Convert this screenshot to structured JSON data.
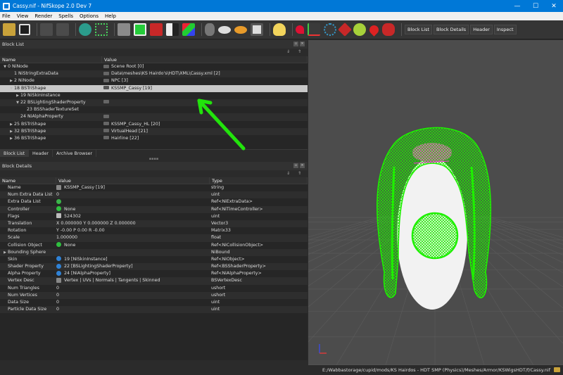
{
  "window": {
    "title": "Cassy.nif - NifSkope 2.0 Dev 7",
    "minimize": "—",
    "maximize": "☐",
    "close": "✕"
  },
  "menu": [
    "File",
    "View",
    "Render",
    "Spells",
    "Options",
    "Help"
  ],
  "toolbar": {
    "block_list": "Block List",
    "block_details": "Block Details",
    "header": "Header",
    "inspect": "Inspect"
  },
  "block_list": {
    "title": "Block List",
    "columns": [
      "Name",
      "Value"
    ],
    "rows": [
      {
        "name": "0 NiNode",
        "value": "Scene Root [0]",
        "indent": 0,
        "arrow": "▼"
      },
      {
        "name": "1 NiStringExtraData",
        "value": "Data\\meshes\\KS Hairdo's\\HDT\\XML\\Cassy.xml [2]",
        "indent": 1,
        "arrow": ""
      },
      {
        "name": "2 NiNode",
        "value": "NPC [3]",
        "indent": 1,
        "arrow": "▶"
      },
      {
        "name": "18 BSTriShape",
        "value": "KSSMP_Cassy [19]",
        "indent": 1,
        "arrow": "▼"
      },
      {
        "name": "19 NiSkinInstance",
        "value": "",
        "indent": 2,
        "arrow": "▶"
      },
      {
        "name": "22 BSLightingShaderProperty",
        "value": "",
        "indent": 2,
        "arrow": "▼"
      },
      {
        "name": "23 BSShaderTextureSet",
        "value": "",
        "indent": 3,
        "arrow": ""
      },
      {
        "name": "24 NiAlphaProperty",
        "value": "",
        "indent": 2,
        "arrow": ""
      },
      {
        "name": "25 BSTriShape",
        "value": "KSSMP_Cassy_HL [20]",
        "indent": 1,
        "arrow": "▶"
      },
      {
        "name": "32 BSTriShape",
        "value": "VirtualHead [21]",
        "indent": 1,
        "arrow": "▶"
      },
      {
        "name": "36 BSTriShape",
        "value": "Hairline [22]",
        "indent": 1,
        "arrow": "▶"
      }
    ],
    "selected_index": 3
  },
  "tabs": [
    "Block List",
    "Header",
    "Archive Browser"
  ],
  "block_details": {
    "title": "Block Details",
    "columns": [
      "Name",
      "Value",
      "Type"
    ],
    "rows": [
      {
        "name": "Name",
        "value": "KSSMP_Cassy [19]",
        "type": "string",
        "icon": "tag"
      },
      {
        "name": "Num Extra Data List",
        "value": "0",
        "type": "uint",
        "icon": ""
      },
      {
        "name": "Extra Data List",
        "value": "",
        "type": "Ref<NiExtraData>",
        "icon": "refresh"
      },
      {
        "name": "Controller",
        "value": "None",
        "type": "Ref<NiTimeController>",
        "icon": "plus"
      },
      {
        "name": "Flags",
        "value": "524302",
        "type": "uint",
        "icon": "flag"
      },
      {
        "name": "Translation",
        "value": "X 0.000000 Y 0.000000 Z 0.000000",
        "type": "Vector3",
        "icon": ""
      },
      {
        "name": "Rotation",
        "value": "Y -0.00 P 0.00 R -0.00",
        "type": "Matrix33",
        "icon": ""
      },
      {
        "name": "Scale",
        "value": "1.000000",
        "type": "float",
        "icon": ""
      },
      {
        "name": "Collision Object",
        "value": "None",
        "type": "Ref<NiCollisionObject>",
        "icon": "plus"
      },
      {
        "name": "Bounding Sphere",
        "value": "",
        "type": "NiBound",
        "icon": ""
      },
      {
        "name": "Skin",
        "value": "19 [NiSkinInstance]",
        "type": "Ref<NiObject>",
        "icon": "link"
      },
      {
        "name": "Shader Property",
        "value": "22 [BSLightingShaderProperty]",
        "type": "Ref<BSShaderProperty>",
        "icon": "link"
      },
      {
        "name": "Alpha Property",
        "value": "24 [NiAlphaProperty]",
        "type": "Ref<NiAlphaProperty>",
        "icon": "link"
      },
      {
        "name": "Vertex Desc",
        "value": "Vertex | UVs | Normals | Tangents | Skinned",
        "type": "BSVertexDesc",
        "icon": "tag"
      },
      {
        "name": "Num Triangles",
        "value": "0",
        "type": "ushort",
        "icon": ""
      },
      {
        "name": "Num Vertices",
        "value": "0",
        "type": "ushort",
        "icon": ""
      },
      {
        "name": "Data Size",
        "value": "0",
        "type": "uint",
        "icon": ""
      },
      {
        "name": "Particle Data Size",
        "value": "0",
        "type": "uint",
        "icon": ""
      }
    ]
  },
  "status": {
    "path": "E:/Wabbastorage/cupid/mods/KS Hairdos - HDT SMP (Physics)/Meshes/Armor/KSWigsHDT/f/Cassy.nif"
  },
  "colors": {
    "accent": "#0078d7",
    "annotation": "#22e30c",
    "mesh_green": "#1ef000",
    "mesh_magenta": "#ff2ee0"
  }
}
